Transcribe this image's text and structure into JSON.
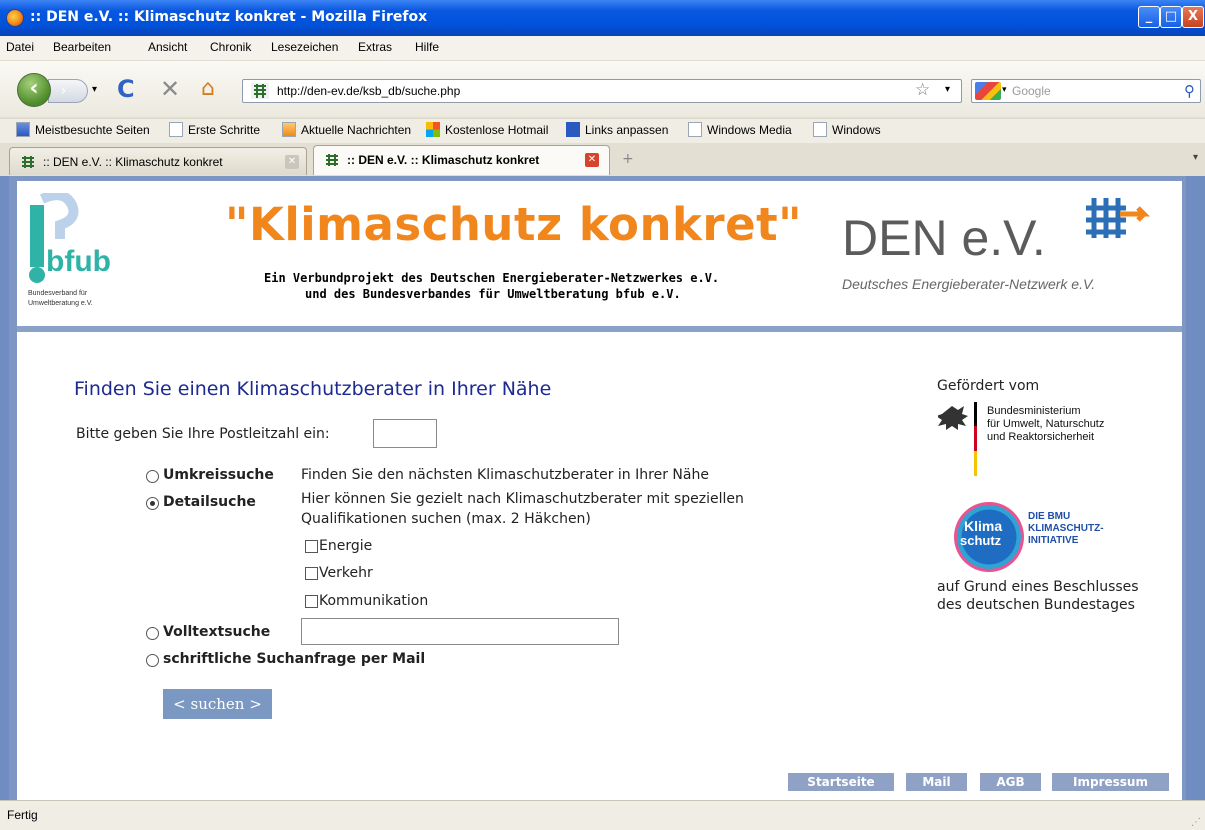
{
  "window": {
    "title": ":: DEN e.V. :: Klimaschutz konkret - Mozilla Firefox",
    "minimize": "_",
    "maximize": "□",
    "close": "X"
  },
  "menu": [
    "Datei",
    "Bearbeiten",
    "Ansicht",
    "Chronik",
    "Lesezeichen",
    "Extras",
    "Hilfe"
  ],
  "toolbar": {
    "url": "http://den-ev.de/ksb_db/suche.php",
    "search_placeholder": "Google"
  },
  "bookmarks": [
    "Meistbesuchte Seiten",
    "Erste Schritte",
    "Aktuelle Nachrichten",
    "Kostenlose Hotmail",
    "Links anpassen",
    "Windows Media",
    "Windows"
  ],
  "tabs": [
    {
      "label": ":: DEN e.V. :: Klimaschutz konkret",
      "active": false
    },
    {
      "label": ":: DEN e.V. :: Klimaschutz konkret",
      "active": true
    }
  ],
  "header": {
    "title": "\"Klimaschutz konkret\"",
    "subtitle_line1": "Ein Verbundprojekt des Deutschen Energieberater-Netzwerkes e.V.",
    "subtitle_line2": "und des Bundesverbandes für Umweltberatung bfub e.V.",
    "den_logo": "DEN e.V.",
    "den_tagline": "Deutsches Energieberater-Netzwerk e.V.",
    "bfub_line1": "Bundesverband für",
    "bfub_line2": "Umweltberatung e.V.",
    "bfub_logo": "bfub"
  },
  "form": {
    "heading": "Finden Sie einen Klimaschutzberater in Ihrer Nähe",
    "plz_label": "Bitte geben Sie Ihre Postleitzahl ein:",
    "plz_value": "",
    "options": {
      "umkreis": {
        "label": "Umkreissuche",
        "desc": "Finden Sie den nächsten Klimaschutzberater in Ihrer Nähe",
        "checked": false
      },
      "detail": {
        "label": "Detailsuche",
        "desc_line1": "Hier können Sie gezielt nach Klimaschutzberater mit speziellen",
        "desc_line2": "Qualifikationen suchen (max. 2 Häkchen)",
        "checked": true
      },
      "volltext": {
        "label": "Volltextsuche",
        "value": "",
        "checked": false
      },
      "mail": {
        "label": "schriftliche Suchanfrage per Mail",
        "checked": false
      }
    },
    "checkboxes": [
      {
        "label": "Energie",
        "checked": false
      },
      {
        "label": "Verkehr",
        "checked": false
      },
      {
        "label": "Kommunikation",
        "checked": false
      }
    ],
    "submit": "< suchen >"
  },
  "sidebar": {
    "funded_by": "Gefördert vom",
    "bmu_line1": "Bundesministerium",
    "bmu_line2": "für Umwelt, Naturschutz",
    "bmu_line3": "und Reaktorsicherheit",
    "klima_badge_line1": "Klima",
    "klima_badge_line2": "schutz",
    "klima_line1": "DIE BMU",
    "klima_line2": "KLIMASCHUTZ-",
    "klima_line3": "INITIATIVE",
    "decision_line1": "auf Grund eines Beschlusses",
    "decision_line2": "des deutschen Bundestages"
  },
  "footer": [
    "Startseite",
    "Mail",
    "AGB",
    "Impressum"
  ],
  "status": "Fertig",
  "colors": {
    "accent_orange": "#f0861c",
    "heading_blue": "#1c2a92",
    "button_blue": "#7a98c2"
  }
}
